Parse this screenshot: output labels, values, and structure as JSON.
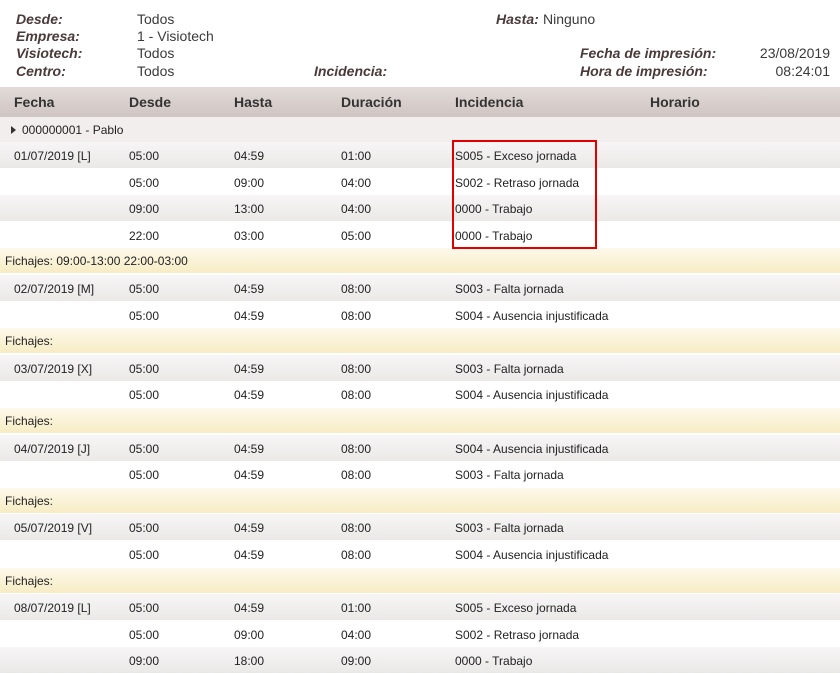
{
  "header": {
    "desde_label": "Desde:",
    "desde_value": "Todos",
    "empresa_label": "Empresa:",
    "empresa_value": "1 - Visiotech",
    "visiotech_label": "Visiotech:",
    "visiotech_value": "Todos",
    "centro_label": "Centro:",
    "centro_value": "Todos",
    "incidencia_label": "Incidencia:",
    "hasta_label": "Hasta:",
    "hasta_value": "Ninguno",
    "fecha_impresion_label": "Fecha de impresión:",
    "fecha_impresion_value": "23/08/2019",
    "hora_impresion_label": "Hora de impresión:",
    "hora_impresion_value": "08:24:01"
  },
  "columns": {
    "fecha": "Fecha",
    "desde": "Desde",
    "hasta": "Hasta",
    "duracion": "Duración",
    "incidencia": "Incidencia",
    "horario": "Horario"
  },
  "group": {
    "label": "000000001 - Pablo"
  },
  "rows": [
    {
      "fecha": "01/07/2019 [L]",
      "desde": "05:00",
      "hasta": "04:59",
      "duracion": "01:00",
      "incidencia": "S005 - Exceso jornada"
    },
    {
      "fecha": "",
      "desde": "05:00",
      "hasta": "09:00",
      "duracion": "04:00",
      "incidencia": "S002 - Retraso jornada"
    },
    {
      "fecha": "",
      "desde": "09:00",
      "hasta": "13:00",
      "duracion": "04:00",
      "incidencia": "0000 - Trabajo"
    },
    {
      "fecha": "",
      "desde": "22:00",
      "hasta": "03:00",
      "duracion": "05:00",
      "incidencia": "0000 - Trabajo"
    },
    {
      "fichajes": "Fichajes:   09:00-13:00   22:00-03:00"
    },
    {
      "fecha": "02/07/2019 [M]",
      "desde": "05:00",
      "hasta": "04:59",
      "duracion": "08:00",
      "incidencia": "S003 - Falta jornada"
    },
    {
      "fecha": "",
      "desde": "05:00",
      "hasta": "04:59",
      "duracion": "08:00",
      "incidencia": "S004 - Ausencia injustificada"
    },
    {
      "fichajes": "Fichajes:"
    },
    {
      "fecha": "03/07/2019 [X]",
      "desde": "05:00",
      "hasta": "04:59",
      "duracion": "08:00",
      "incidencia": "S003 - Falta jornada"
    },
    {
      "fecha": "",
      "desde": "05:00",
      "hasta": "04:59",
      "duracion": "08:00",
      "incidencia": "S004 - Ausencia injustificada"
    },
    {
      "fichajes": "Fichajes:"
    },
    {
      "fecha": "04/07/2019 [J]",
      "desde": "05:00",
      "hasta": "04:59",
      "duracion": "08:00",
      "incidencia": "S004 - Ausencia injustificada"
    },
    {
      "fecha": "",
      "desde": "05:00",
      "hasta": "04:59",
      "duracion": "08:00",
      "incidencia": "S003 - Falta jornada"
    },
    {
      "fichajes": "Fichajes:"
    },
    {
      "fecha": "05/07/2019 [V]",
      "desde": "05:00",
      "hasta": "04:59",
      "duracion": "08:00",
      "incidencia": "S003 - Falta jornada"
    },
    {
      "fecha": "",
      "desde": "05:00",
      "hasta": "04:59",
      "duracion": "08:00",
      "incidencia": "S004 - Ausencia injustificada"
    },
    {
      "fichajes": "Fichajes:"
    },
    {
      "fecha": "08/07/2019 [L]",
      "desde": "05:00",
      "hasta": "04:59",
      "duracion": "01:00",
      "incidencia": "S005 - Exceso jornada"
    },
    {
      "fecha": "",
      "desde": "05:00",
      "hasta": "09:00",
      "duracion": "04:00",
      "incidencia": "S002 - Retraso jornada"
    },
    {
      "fecha": "",
      "desde": "09:00",
      "hasta": "18:00",
      "duracion": "09:00",
      "incidencia": "0000 - Trabajo"
    }
  ]
}
